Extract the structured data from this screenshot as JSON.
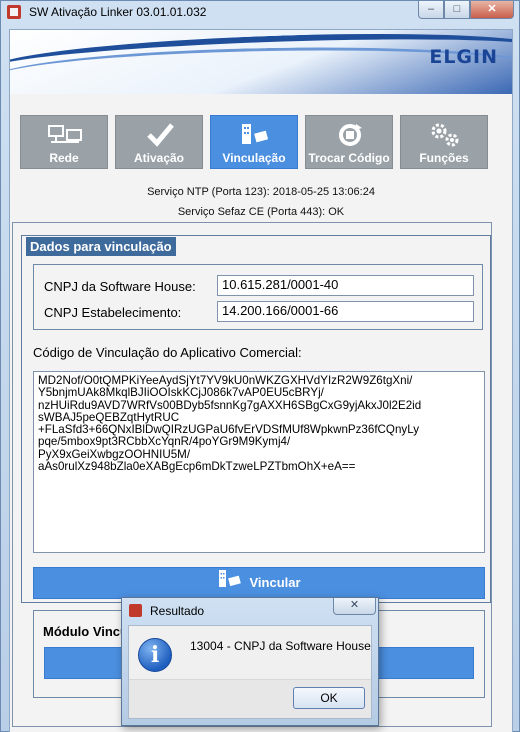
{
  "window": {
    "title": "SW Ativação Linker 03.01.01.032",
    "minimize": "–",
    "maximize": "□",
    "close": "✕"
  },
  "banner": {
    "logo_text": "ELGIN"
  },
  "nav": {
    "items": [
      {
        "label": "Rede",
        "icon": "network-icon"
      },
      {
        "label": "Ativação",
        "icon": "check-icon"
      },
      {
        "label": "Vinculação",
        "icon": "link-icon"
      },
      {
        "label": "Trocar Código",
        "icon": "refresh-key-icon"
      },
      {
        "label": "Funções",
        "icon": "gears-icon"
      }
    ],
    "active": "Vinculação"
  },
  "status": {
    "ntp": "Serviço NTP (Porta 123): 2018-05-25 13:06:24",
    "sefaz": "Serviço Sefaz CE (Porta 443): OK"
  },
  "form": {
    "group_title": "Dados para vinculação",
    "software_house_label": "CNPJ da Software House:",
    "software_house_value": "10.615.281/0001-40",
    "estabelecimento_label": "CNPJ Estabelecimento:",
    "estabelecimento_value": "14.200.166/0001-66",
    "code_label": "Código de Vinculação do Aplicativo Comercial:",
    "code_value": "MD2Nof/O0tQMPKiYeeAydSjYt7YV9kU0nWKZGXHVdYIzR2W9Z6tgXni/\nY5bnjmUAk8MkqlBJIiOOIskKCjJ086k7vAP0EU5cBRYj/\nnzHUiRdu9AVD7WRfVs00BDyb5fsnnKg7gAXXH6SBgCxG9yjAkxJ0l2E2id\nsWBAJ5peQEBZqtHytRUC\n+FLaSfd3+66QNxIBlDwQIRzUGPaU6fvErVDSfMUf8WpkwnPz36fCQnyLy\npqe/5mbox9pt3RCbbXcYqnR/4poYGr9M9Kymj4/\nPyX9xGeiXwbgzOOHNIU5M/\naAs0rulXz948bZla0eXABgEcp6mDkTzweLPZTbmOhX+eA==",
    "vincular_label": "Vincular",
    "modulo_label": "Módulo Vincu"
  },
  "dialog": {
    "title": "Resultado",
    "close": "✕",
    "message": "13004 - CNPJ da Software House",
    "ok_label": "OK"
  }
}
